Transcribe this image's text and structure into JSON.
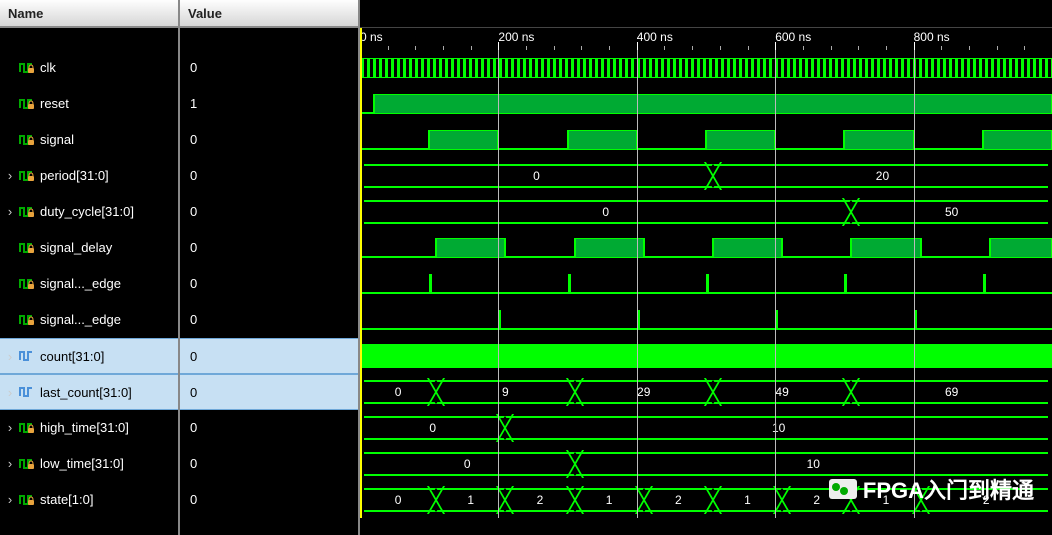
{
  "headers": {
    "name": "Name",
    "value": "Value"
  },
  "signals": [
    {
      "name": "clk",
      "value": "0",
      "type": "scalar",
      "selected": false
    },
    {
      "name": "reset",
      "value": "1",
      "type": "scalar",
      "selected": false
    },
    {
      "name": "signal",
      "value": "0",
      "type": "scalar",
      "selected": false
    },
    {
      "name": "period[31:0]",
      "value": "0",
      "type": "bus",
      "selected": false,
      "expandable": true
    },
    {
      "name": "duty_cycle[31:0]",
      "value": "0",
      "type": "bus",
      "selected": false,
      "expandable": true
    },
    {
      "name": "signal_delay",
      "value": "0",
      "type": "scalar",
      "selected": false
    },
    {
      "name": "signal..._edge",
      "value": "0",
      "type": "scalar",
      "selected": false
    },
    {
      "name": "signal..._edge",
      "value": "0",
      "type": "scalar",
      "selected": false
    },
    {
      "name": "count[31:0]",
      "value": "0",
      "type": "bus",
      "selected": true,
      "expandable": true
    },
    {
      "name": "last_count[31:0]",
      "value": "0",
      "type": "bus",
      "selected": true,
      "expandable": true
    },
    {
      "name": "high_time[31:0]",
      "value": "0",
      "type": "bus",
      "selected": false,
      "expandable": true
    },
    {
      "name": "low_time[31:0]",
      "value": "0",
      "type": "bus",
      "selected": false,
      "expandable": true
    },
    {
      "name": "state[1:0]",
      "value": "0",
      "type": "bus",
      "selected": false,
      "expandable": true
    }
  ],
  "timescale": {
    "ticks": [
      "0 ns",
      "200 ns",
      "400 ns",
      "600 ns",
      "800 ns"
    ],
    "range_ns": 1000
  },
  "waveforms": {
    "reset": [
      {
        "t": 0,
        "v": 0
      },
      {
        "t": 20,
        "v": 1
      }
    ],
    "signal": [
      {
        "t": 0,
        "v": 0
      },
      {
        "t": 100,
        "v": 1
      },
      {
        "t": 200,
        "v": 0
      },
      {
        "t": 300,
        "v": 1
      },
      {
        "t": 400,
        "v": 0
      },
      {
        "t": 500,
        "v": 1
      },
      {
        "t": 600,
        "v": 0
      },
      {
        "t": 700,
        "v": 1
      },
      {
        "t": 800,
        "v": 0
      },
      {
        "t": 900,
        "v": 1
      }
    ],
    "period": [
      {
        "t": 0,
        "val": "0"
      },
      {
        "t": 510,
        "val": "20"
      }
    ],
    "duty_cycle": [
      {
        "t": 0,
        "val": "0"
      },
      {
        "t": 710,
        "val": "50"
      }
    ],
    "signal_delay": [
      {
        "t": 0,
        "v": 0
      },
      {
        "t": 110,
        "v": 1
      },
      {
        "t": 210,
        "v": 0
      },
      {
        "t": 310,
        "v": 1
      },
      {
        "t": 410,
        "v": 0
      },
      {
        "t": 510,
        "v": 1
      },
      {
        "t": 610,
        "v": 0
      },
      {
        "t": 710,
        "v": 1
      },
      {
        "t": 810,
        "v": 0
      },
      {
        "t": 910,
        "v": 1
      }
    ],
    "rising_edge_pulses": [
      100,
      300,
      500,
      700,
      900
    ],
    "falling_edge_pulses": [
      200,
      400,
      600,
      800
    ],
    "last_count": [
      {
        "t": 0,
        "val": "0"
      },
      {
        "t": 110,
        "val": "9"
      },
      {
        "t": 310,
        "val": "29"
      },
      {
        "t": 510,
        "val": "49"
      },
      {
        "t": 710,
        "val": "69"
      }
    ],
    "high_time": [
      {
        "t": 0,
        "val": "0"
      },
      {
        "t": 210,
        "val": "10"
      }
    ],
    "low_time": [
      {
        "t": 0,
        "val": "0"
      },
      {
        "t": 310,
        "val": "10"
      }
    ],
    "state": [
      {
        "t": 0,
        "val": "0"
      },
      {
        "t": 110,
        "val": "1"
      },
      {
        "t": 210,
        "val": "2"
      },
      {
        "t": 310,
        "val": "1"
      },
      {
        "t": 410,
        "val": "2"
      },
      {
        "t": 510,
        "val": "1"
      },
      {
        "t": 610,
        "val": "2"
      },
      {
        "t": 710,
        "val": "1"
      },
      {
        "t": 810,
        "val": "2"
      }
    ]
  },
  "cursor_ns": 0,
  "watermark": "FPGA入门到精通"
}
